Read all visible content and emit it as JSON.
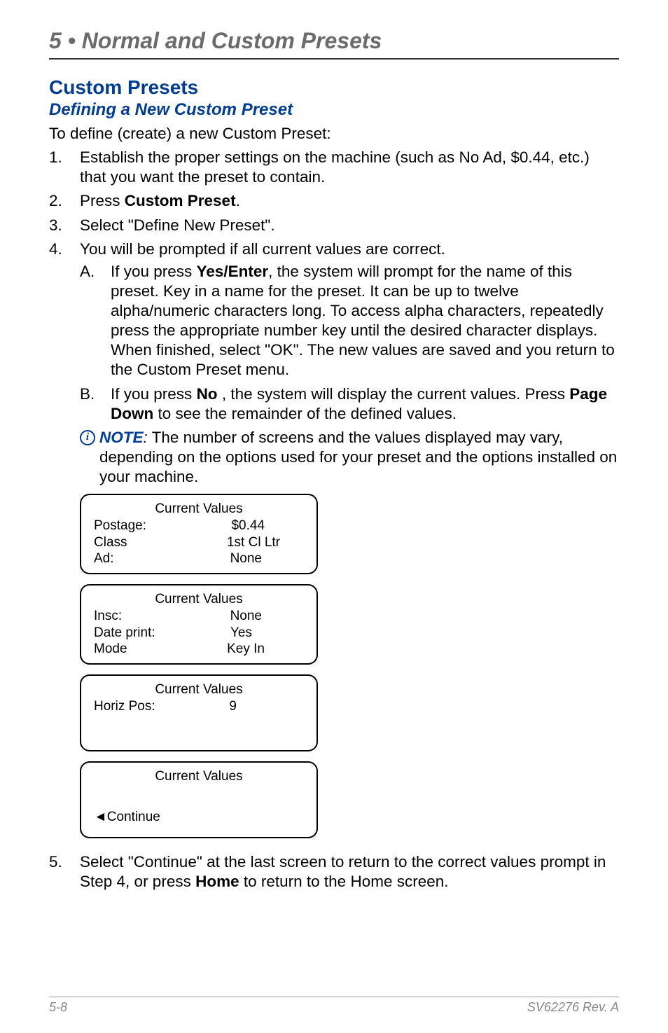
{
  "chapterTitle": "5 • Normal and Custom Presets",
  "sectionTitle": "Custom Presets",
  "subsectionTitle": "Defining a New Custom Preset",
  "intro": "To define (create) a new Custom Preset:",
  "steps": {
    "s1": " Establish the proper settings on the machine (such as No Ad, $0.44, etc.) that you want the preset to contain.",
    "s2a": "Press ",
    "s2b": "Custom Preset",
    "s2c": ".",
    "s3": "Select \"Define New Preset\".",
    "s4": "You will be prompted if all current values are correct.",
    "s4a_1": "If you press ",
    "s4a_2": "Yes/Enter",
    "s4a_3": ", the system will prompt for the name of this preset. Key in a name for the preset. It can be up to twelve alpha/numeric characters long. To access alpha characters, repeatedly press the appropriate number key until the desired character displays. When finished, select \"OK\". The new values are saved and you return to the Custom Preset menu.",
    "s4b_1": "If you press ",
    "s4b_2": "No",
    "s4b_3": " , the system will display the current values. Press ",
    "s4b_4": "Page Down",
    "s4b_5": " to see the remainder of the defined values.",
    "s5_1": "Select \"Continue\" at the last screen to return to the correct values prompt in Step 4, or press ",
    "s5_2": "Home",
    "s5_3": " to return to the Home screen."
  },
  "note": {
    "label": "NOTE",
    "colon": ":",
    "text": " The number of screens and the values displayed may vary, depending on the options used for your preset and the options installed on your machine."
  },
  "screens": [
    {
      "title": "Current Values",
      "rows": [
        {
          "l": "Postage:",
          "r": "$0.44"
        },
        {
          "l": "Class",
          "r": "1st Cl Ltr"
        },
        {
          "l": "Ad:",
          "r": "None"
        }
      ]
    },
    {
      "title": "Current Values",
      "rows": [
        {
          "l": "Insc:",
          "r": "None"
        },
        {
          "l": "Date print:",
          "r": "Yes"
        },
        {
          "l": "Mode",
          "r": "Key In"
        }
      ]
    },
    {
      "title": "Current Values",
      "rows": [
        {
          "l": "Horiz Pos:",
          "r": "9"
        }
      ]
    },
    {
      "title": "Current Values",
      "continue": "◄Continue"
    }
  ],
  "footer": {
    "left": "5-8",
    "right": "SV62276 Rev. A"
  },
  "nums": {
    "n1": "1.",
    "n2": "2.",
    "n3": "3.",
    "n4": "4.",
    "n5": "5.",
    "a": "A.",
    "b": "B."
  }
}
